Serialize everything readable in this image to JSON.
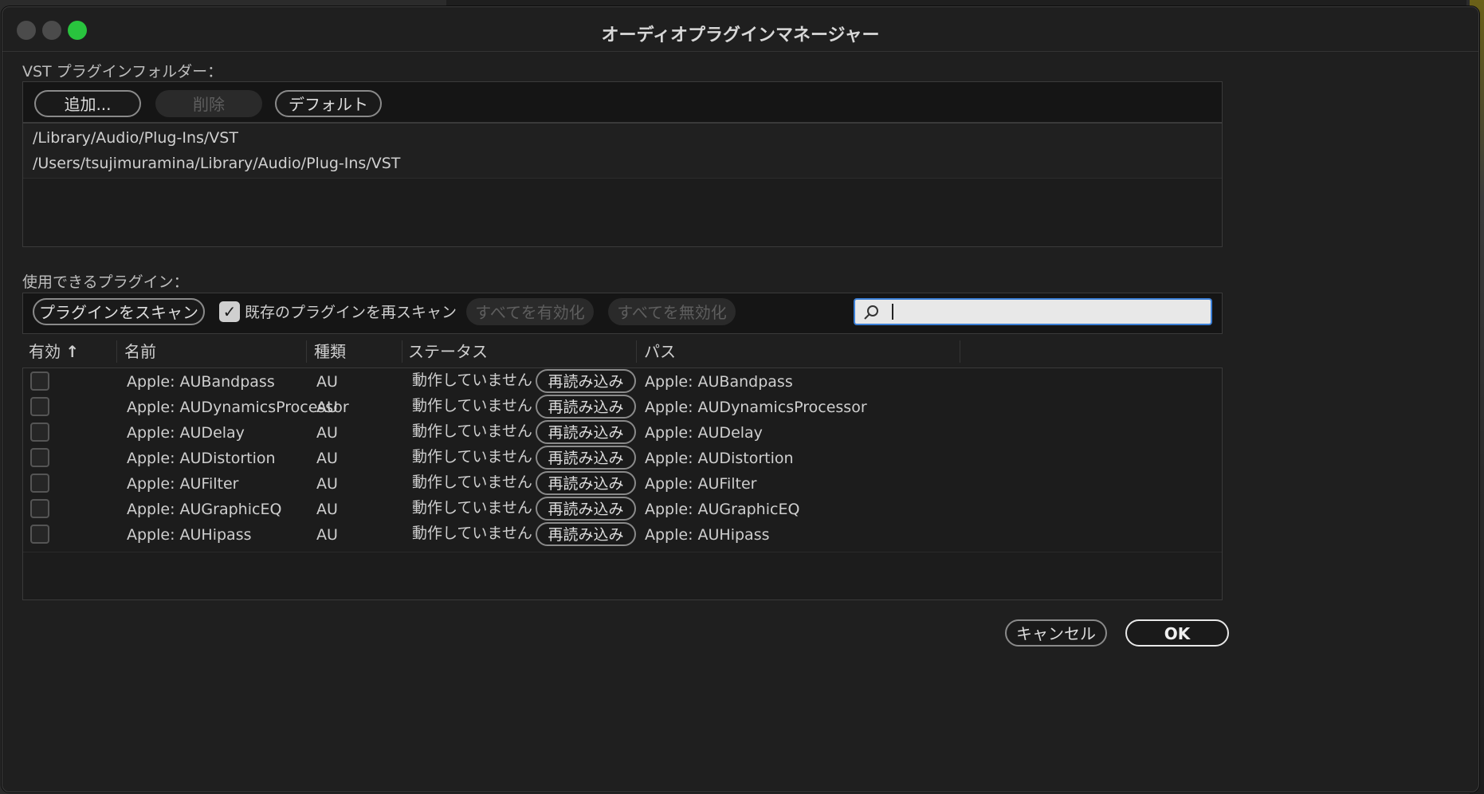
{
  "window": {
    "title": "オーディオプラグインマネージャー"
  },
  "vst": {
    "label": "VST プラグインフォルダー：",
    "add_label": "追加...",
    "delete_label": "削除",
    "default_label": "デフォルト",
    "folders": [
      "/Library/Audio/Plug-Ins/VST",
      "/Users/tsujimuramina/Library/Audio/Plug-Ins/VST"
    ]
  },
  "plugins": {
    "label": "使用できるプラグイン：",
    "scan_label": "プラグインをスキャン",
    "rescan_label": "既存のプラグインを再スキャン",
    "rescan_checked": true,
    "enable_all_label": "すべてを有効化",
    "disable_all_label": "すべてを無効化",
    "search_value": "",
    "columns": {
      "enabled": "有効",
      "name": "名前",
      "type": "種類",
      "status": "ステータス",
      "path": "パス"
    },
    "sort_indicator": "↑",
    "reload_label": "再読み込み",
    "rows": [
      {
        "name": "Apple: AUBandpass",
        "type": "AU",
        "status": "動作していません",
        "path": "Apple: AUBandpass",
        "enabled": false
      },
      {
        "name": "Apple: AUDynamicsProcessor",
        "type": "AU",
        "status": "動作していません",
        "path": "Apple: AUDynamicsProcessor",
        "enabled": false
      },
      {
        "name": "Apple: AUDelay",
        "type": "AU",
        "status": "動作していません",
        "path": "Apple: AUDelay",
        "enabled": false
      },
      {
        "name": "Apple: AUDistortion",
        "type": "AU",
        "status": "動作していません",
        "path": "Apple: AUDistortion",
        "enabled": false
      },
      {
        "name": "Apple: AUFilter",
        "type": "AU",
        "status": "動作していません",
        "path": "Apple: AUFilter",
        "enabled": false
      },
      {
        "name": "Apple: AUGraphicEQ",
        "type": "AU",
        "status": "動作していません",
        "path": "Apple: AUGraphicEQ",
        "enabled": false
      },
      {
        "name": "Apple: AUHipass",
        "type": "AU",
        "status": "動作していません",
        "path": "Apple: AUHipass",
        "enabled": false
      }
    ]
  },
  "footer": {
    "cancel_label": "キャンセル",
    "ok_label": "OK"
  },
  "colors": {
    "accent": "#3b7fd6",
    "close_green": "#29c43e",
    "window_bg": "#1f1f1f"
  }
}
